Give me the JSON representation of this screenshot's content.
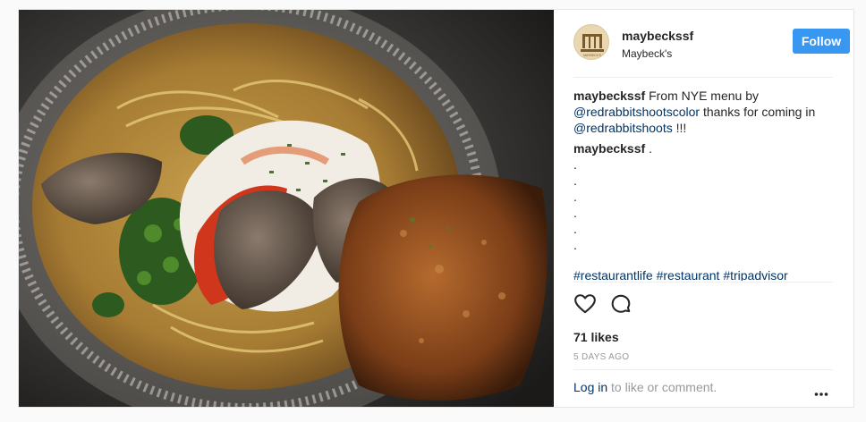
{
  "post": {
    "username": "maybeckssf",
    "location": "Maybeck's",
    "follow_label": "Follow",
    "caption": {
      "username": "maybeckssf",
      "text_1": "From NYE menu by",
      "mention_1": "@redrabbitshootscolor",
      "text_2": "thanks for coming in",
      "mention_2": "@redrabbitshoots",
      "text_3": "!!!"
    },
    "comment": {
      "username": "maybeckssf",
      "text": ".",
      "dots": [
        ".",
        ".",
        ".",
        ".",
        ".",
        "."
      ]
    },
    "hashtags": "#restaurantlife #restaurant #tripadvisor",
    "likes": "71 likes",
    "time": "5 DAYS AGO",
    "login_link": "Log in",
    "login_text": "to like or comment.",
    "avatar_logo_text": "MAYBECK'S"
  },
  "colors": {
    "accent": "#3897f0",
    "link": "#003569",
    "muted": "#999999"
  },
  "icons": {
    "like": "heart-outline-icon",
    "comment": "speech-bubble-icon",
    "more": "three-dots-icon"
  }
}
